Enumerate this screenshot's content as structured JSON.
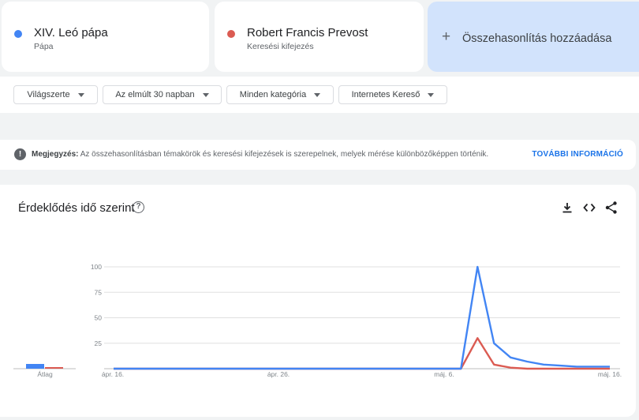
{
  "terms": [
    {
      "title": "XIV. Leó pápa",
      "subtitle": "Pápa",
      "color": "#4285f4"
    },
    {
      "title": "Robert Francis Prevost",
      "subtitle": "Keresési kifejezés",
      "color": "#db5b52"
    }
  ],
  "add_compare": {
    "label": "Összehasonlítás hozzáadása",
    "icon": "plus-icon"
  },
  "filters": [
    {
      "label": "Világszerte"
    },
    {
      "label": "Az elmúlt 30 napban"
    },
    {
      "label": "Minden kategória"
    },
    {
      "label": "Internetes Kereső"
    }
  ],
  "note": {
    "icon": "exclamation-icon",
    "bold": "Megjegyzés:",
    "text": "Az összehasonlításban témakörök és keresési kifejezések is szerepelnek, melyek mérése különbözőképpen történik.",
    "link": "TOVÁBBI INFORMÁCIÓ"
  },
  "chart_section": {
    "title": "Érdeklődés idő szerint",
    "icons": [
      "help-icon",
      "download-icon",
      "embed-code-icon",
      "share-icon"
    ]
  },
  "chart_data": {
    "type": "line",
    "average": {
      "label": "Átlag",
      "values": [
        3,
        1
      ]
    },
    "x_tick_labels": [
      "ápr. 16.",
      "ápr. 26.",
      "máj. 6.",
      "máj. 16."
    ],
    "y_tick_labels": [
      "100",
      "75",
      "50",
      "25"
    ],
    "ylim": [
      0,
      100
    ],
    "grid": true,
    "x": [
      "ápr. 16.",
      "ápr. 17.",
      "ápr. 18.",
      "ápr. 19.",
      "ápr. 20.",
      "ápr. 21.",
      "ápr. 22.",
      "ápr. 23.",
      "ápr. 24.",
      "ápr. 25.",
      "ápr. 26.",
      "ápr. 27.",
      "ápr. 28.",
      "ápr. 29.",
      "ápr. 30.",
      "máj. 1.",
      "máj. 2.",
      "máj. 3.",
      "máj. 4.",
      "máj. 5.",
      "máj. 6.",
      "máj. 7.",
      "máj. 8.",
      "máj. 9.",
      "máj. 10.",
      "máj. 11.",
      "máj. 12.",
      "máj. 13.",
      "máj. 14.",
      "máj. 15.",
      "máj. 16."
    ],
    "series": [
      {
        "name": "XIV. Leó pápa",
        "color": "#4285f4",
        "values": [
          0,
          0,
          0,
          0,
          0,
          0,
          0,
          0,
          0,
          0,
          0,
          0,
          0,
          0,
          0,
          0,
          0,
          0,
          0,
          0,
          0,
          0,
          100,
          25,
          11,
          7,
          4,
          3,
          2,
          2,
          2
        ]
      },
      {
        "name": "Robert Francis Prevost",
        "color": "#db5b52",
        "values": [
          0,
          0,
          0,
          0,
          0,
          0,
          0,
          0,
          0,
          0,
          0,
          0,
          0,
          0,
          0,
          0,
          0,
          0,
          0,
          0,
          0,
          0,
          30,
          4,
          1,
          0,
          0,
          0,
          0,
          0,
          0
        ]
      }
    ]
  }
}
